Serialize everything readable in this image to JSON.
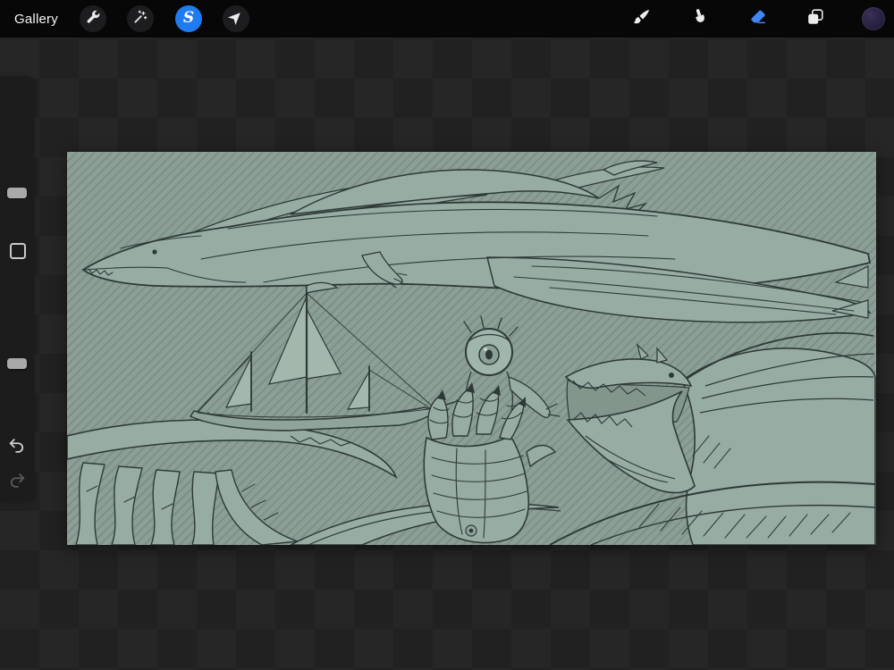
{
  "app_title": "Procreate canvas view",
  "toolbar": {
    "gallery_label": "Gallery",
    "selection_glyph": "S",
    "accent_color": "#1f7bf2",
    "left_tools": [
      {
        "id": "actions",
        "icon": "wrench-icon",
        "active": false
      },
      {
        "id": "adjustments",
        "icon": "magic-wand-icon",
        "active": false
      },
      {
        "id": "selection",
        "icon": "selection-s-icon",
        "active": true
      },
      {
        "id": "transform",
        "icon": "transform-arrow-icon",
        "active": false
      }
    ],
    "right_tools": [
      {
        "id": "paint",
        "icon": "brush-icon",
        "active": false
      },
      {
        "id": "smudge",
        "icon": "smudge-icon",
        "active": false
      },
      {
        "id": "erase",
        "icon": "eraser-icon",
        "active": true,
        "color": "#3f86f7"
      },
      {
        "id": "layers",
        "icon": "layers-icon",
        "active": false
      },
      {
        "id": "color",
        "icon": "color-swatch",
        "swatch_color": "#2b2343"
      }
    ]
  },
  "sidebar": {
    "brush_size_slider": {
      "orientation": "vertical",
      "value_pct": 50
    },
    "modify_button": {
      "shape": "square-outline"
    },
    "opacity_slider": {
      "orientation": "vertical",
      "value_pct": 53
    },
    "undo_enabled": true,
    "redo_enabled": false
  },
  "canvas": {
    "background_color": "#8b9f96",
    "selection_stripes": true,
    "stripe_direction": "diagonal",
    "sketch_line_color": "#2e3936",
    "sketch_fill_color": "#97ada4",
    "subjects": [
      "flying leviathan dragon",
      "sailing ship",
      "one-eyed monster with segmented claw hand",
      "roaring dragon head with open jaws",
      "tentacled sea creature"
    ]
  }
}
